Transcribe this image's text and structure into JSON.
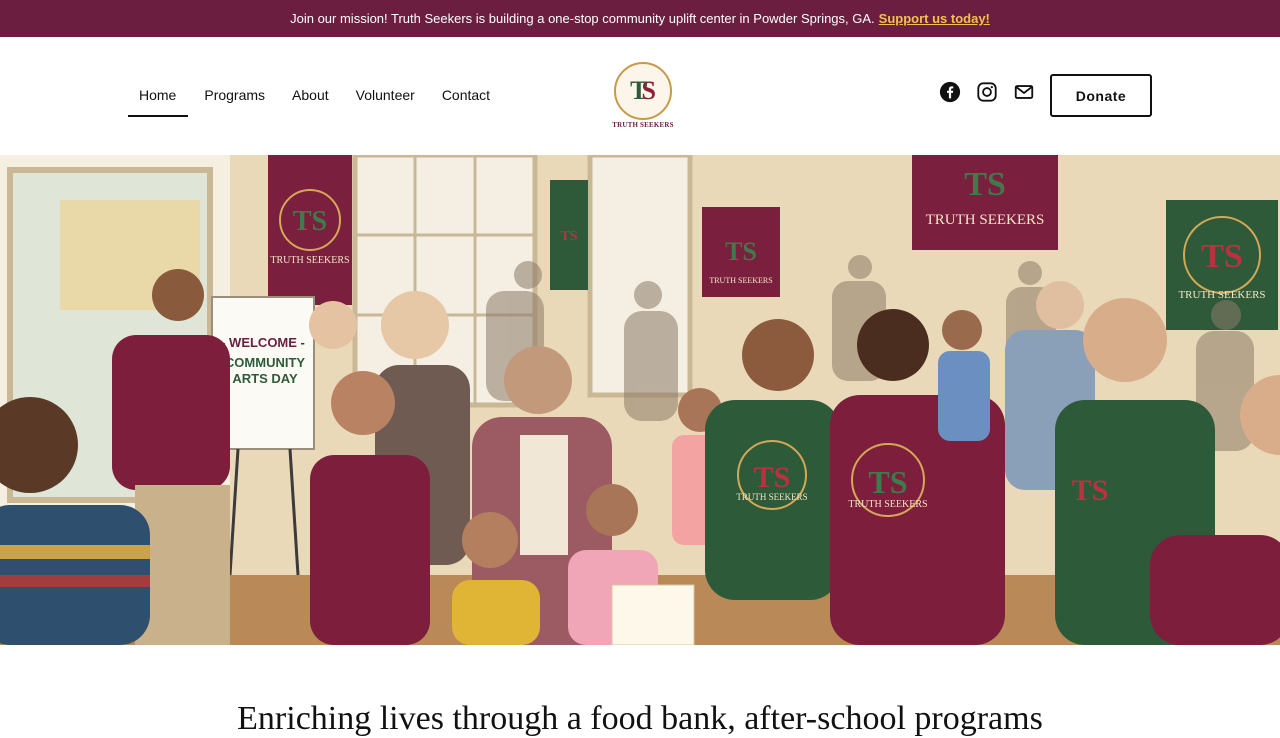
{
  "announcement": {
    "text": "Join our mission! Truth Seekers is building a one-stop community uplift center in Powder Springs, GA.",
    "link_label": "Support us today!"
  },
  "nav": {
    "items": [
      {
        "label": "Home",
        "active": true
      },
      {
        "label": "Programs",
        "active": false
      },
      {
        "label": "About",
        "active": false
      },
      {
        "label": "Volunteer",
        "active": false
      },
      {
        "label": "Contact",
        "active": false
      }
    ]
  },
  "logo": {
    "monogram_t": "T",
    "monogram_s": "S",
    "text": "TRUTH SEEKERS"
  },
  "social": {
    "icons": [
      "facebook-icon",
      "instagram-icon",
      "mail-icon"
    ]
  },
  "header": {
    "donate_label": "Donate"
  },
  "hero": {
    "sign_lines": [
      "- WELCOME -",
      "COMMUNITY",
      "ARTS DAY"
    ],
    "banner_text": "TRUTH SEEKERS",
    "shirt_text": "TRUTH SEEKERS"
  },
  "main": {
    "headline": "Enriching lives through a food bank, after-school programs"
  },
  "colors": {
    "brand_maroon": "#6b1e3f",
    "accent_gold": "#f2c14e",
    "brand_green": "#2f5a3a"
  }
}
